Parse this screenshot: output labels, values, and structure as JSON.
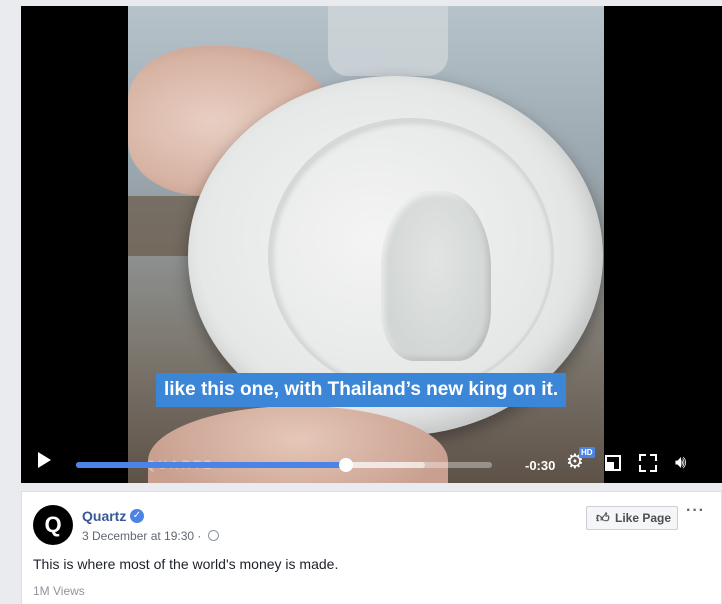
{
  "video": {
    "caption": "like this one, with Thailand’s new king on it.",
    "watermark": "QUARTZ",
    "progress_fraction": 0.65,
    "buffered_fraction": 0.84,
    "time_remaining": "-0:30",
    "hd_badge": "HD",
    "icons": {
      "play": "play-icon",
      "settings": "gear-icon",
      "pip": "picture-in-picture-icon",
      "fullscreen": "fullscreen-icon",
      "volume": "volume-icon"
    },
    "accent_color": "#4b84e6"
  },
  "post": {
    "avatar_letter": "Q",
    "page_name": "Quartz",
    "timestamp": "3 December at 19:30 ·",
    "like_page_label": "Like Page",
    "more_label": "···",
    "text": "This is where most of the world's money is made.",
    "views": "1M Views",
    "link_color": "#385898"
  }
}
